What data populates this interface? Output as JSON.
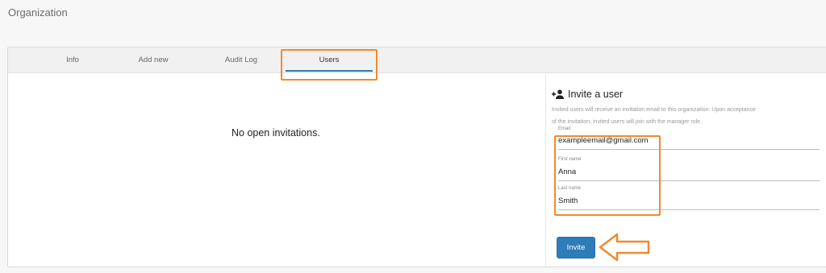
{
  "header": {
    "title": "Organization"
  },
  "tabs": [
    {
      "label": "Info"
    },
    {
      "label": "Add new"
    },
    {
      "label": "Audit Log"
    },
    {
      "label": "Users",
      "active": true
    }
  ],
  "invitations": {
    "empty_message": "No open invitations."
  },
  "invite": {
    "heading": "Invite a user",
    "icon": "person-add-icon",
    "description": "Invited users will receive an invitation email to this organization. Upon acceptance of the invitation, invited users will join with the manager role.",
    "email": {
      "label": "Email",
      "value": "exampleemail@gmail.com"
    },
    "first_name": {
      "label": "First name",
      "value": "Anna"
    },
    "last_name": {
      "label": "Last name",
      "value": "Smith"
    },
    "button_label": "Invite"
  },
  "colors": {
    "accent": "#2e7cb8",
    "highlight": "#f08a2e"
  }
}
